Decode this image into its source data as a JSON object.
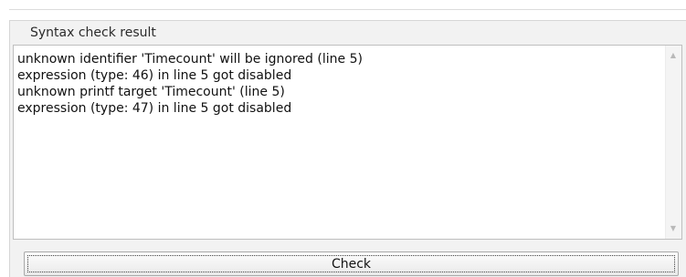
{
  "panel": {
    "title": "Syntax check result",
    "lines": [
      "unknown identifier 'Timecount' will be ignored (line 5)",
      "expression (type: 46) in line 5 got disabled",
      "unknown printf target 'Timecount' (line 5)",
      "expression (type: 47) in line 5 got disabled"
    ]
  },
  "buttons": {
    "check_label": "Check"
  },
  "icons": {
    "scroll_up": "scroll-up-icon",
    "scroll_down": "scroll-down-icon"
  }
}
